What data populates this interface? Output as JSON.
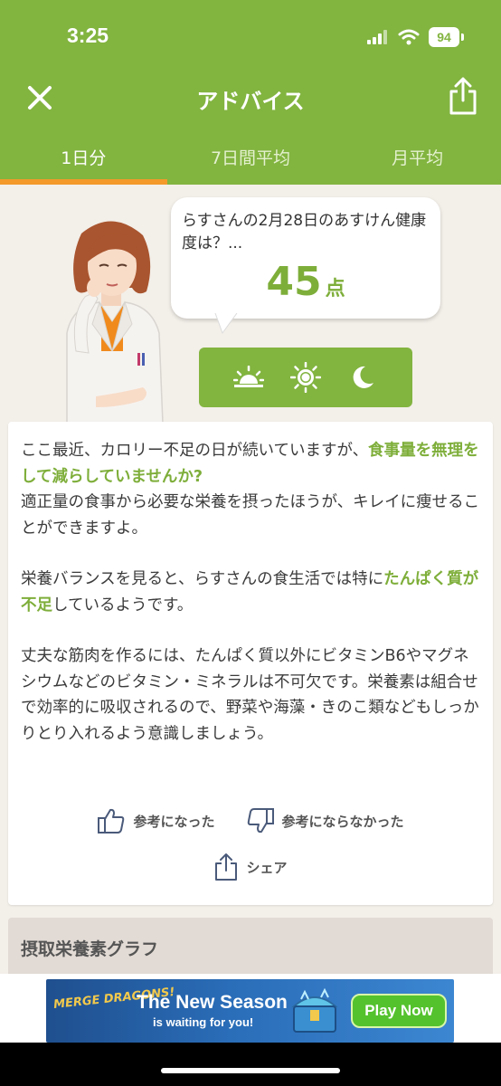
{
  "status_bar": {
    "time": "3:25",
    "battery": "94"
  },
  "nav": {
    "title": "アドバイス",
    "close_icon": "close-icon",
    "share_icon": "share-icon"
  },
  "tabs": [
    {
      "label": "1日分",
      "active": true
    },
    {
      "label": "7日間平均",
      "active": false
    },
    {
      "label": "月平均",
      "active": false
    }
  ],
  "bubble": {
    "question": "らすさんの2月28日のあすけん健康度は？...",
    "score": "45",
    "unit": "点"
  },
  "time_of_day": {
    "icons": [
      "sunrise-icon",
      "sun-icon",
      "moon-icon"
    ]
  },
  "advice": {
    "p1_a": "ここ最近、カロリー不足の日が続いていますが、",
    "p1_hl": "食事量を無理をして減らしていませんか?",
    "p1_b": "適正量の食事から必要な栄養を摂ったほうが、キレイに痩せることができますよ。",
    "p2_a": "栄養バランスを見ると、らすさんの食生活では特に",
    "p2_hl": "たんぱく質が不足",
    "p2_b": "しているようです。",
    "p3": "丈夫な筋肉を作るには、たんぱく質以外にビタミンB6やマグネシウムなどのビタミン・ミネラルは不可欠です。栄養素は組合せで効率的に吸収されるので、野菜や海藻・きのこ類などもしっかりとり入れるよう意識しましょう。"
  },
  "feedback": {
    "helpful": "参考になった",
    "not_helpful": "参考にならなかった",
    "share": "シェア"
  },
  "section": {
    "title": "摂取栄養素グラフ"
  },
  "ad": {
    "logo": "MERGE DRAGONS!",
    "headline": "The New Season",
    "subline": "is waiting for you!",
    "cta": "Play Now"
  },
  "colors": {
    "accent": "#82b440",
    "tab_indicator": "#f39a2a",
    "highlight": "#7eae3a",
    "background": "#f3efe9"
  }
}
